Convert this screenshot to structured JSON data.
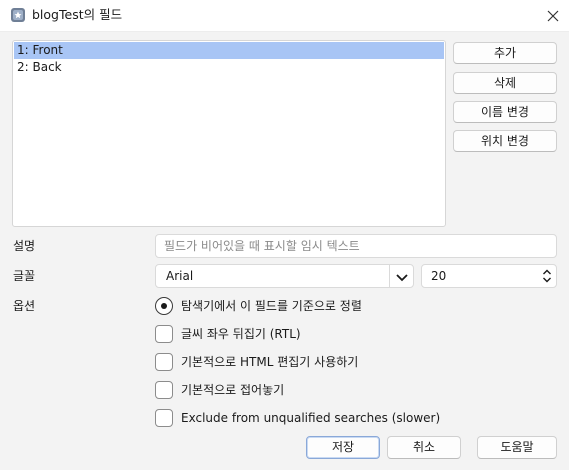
{
  "window": {
    "title": "blogTest의 필드",
    "icon": "app-icon",
    "close_icon": "close-icon"
  },
  "fields": {
    "items": [
      {
        "label": "1: Front",
        "selected": true
      },
      {
        "label": "2: Back",
        "selected": false
      }
    ]
  },
  "side_buttons": {
    "add": "추가",
    "delete": "삭제",
    "rename": "이름 변경",
    "reposition": "위치 변경"
  },
  "form": {
    "description_label": "설명",
    "description_placeholder": "필드가 비어있을 때 표시할 임시 텍스트",
    "font_label": "글꼴",
    "font_value": "Arial",
    "font_size_value": "20",
    "options_label": "옵션"
  },
  "options": [
    {
      "label": "탐색기에서 이 필드를 기준으로 정렬",
      "type": "radio",
      "checked": true
    },
    {
      "label": "글씨 좌우 뒤집기 (RTL)",
      "type": "checkbox",
      "checked": false
    },
    {
      "label": "기본적으로 HTML 편집기 사용하기",
      "type": "checkbox",
      "checked": false
    },
    {
      "label": "기본적으로 접어놓기",
      "type": "checkbox",
      "checked": false
    },
    {
      "label": "Exclude from unqualified searches (slower)",
      "type": "checkbox",
      "checked": false
    }
  ],
  "bottom_buttons": {
    "save": "저장",
    "cancel": "취소",
    "help": "도움말"
  },
  "colors": {
    "selection": "#a8c5f5",
    "background": "#f3f3f3"
  }
}
